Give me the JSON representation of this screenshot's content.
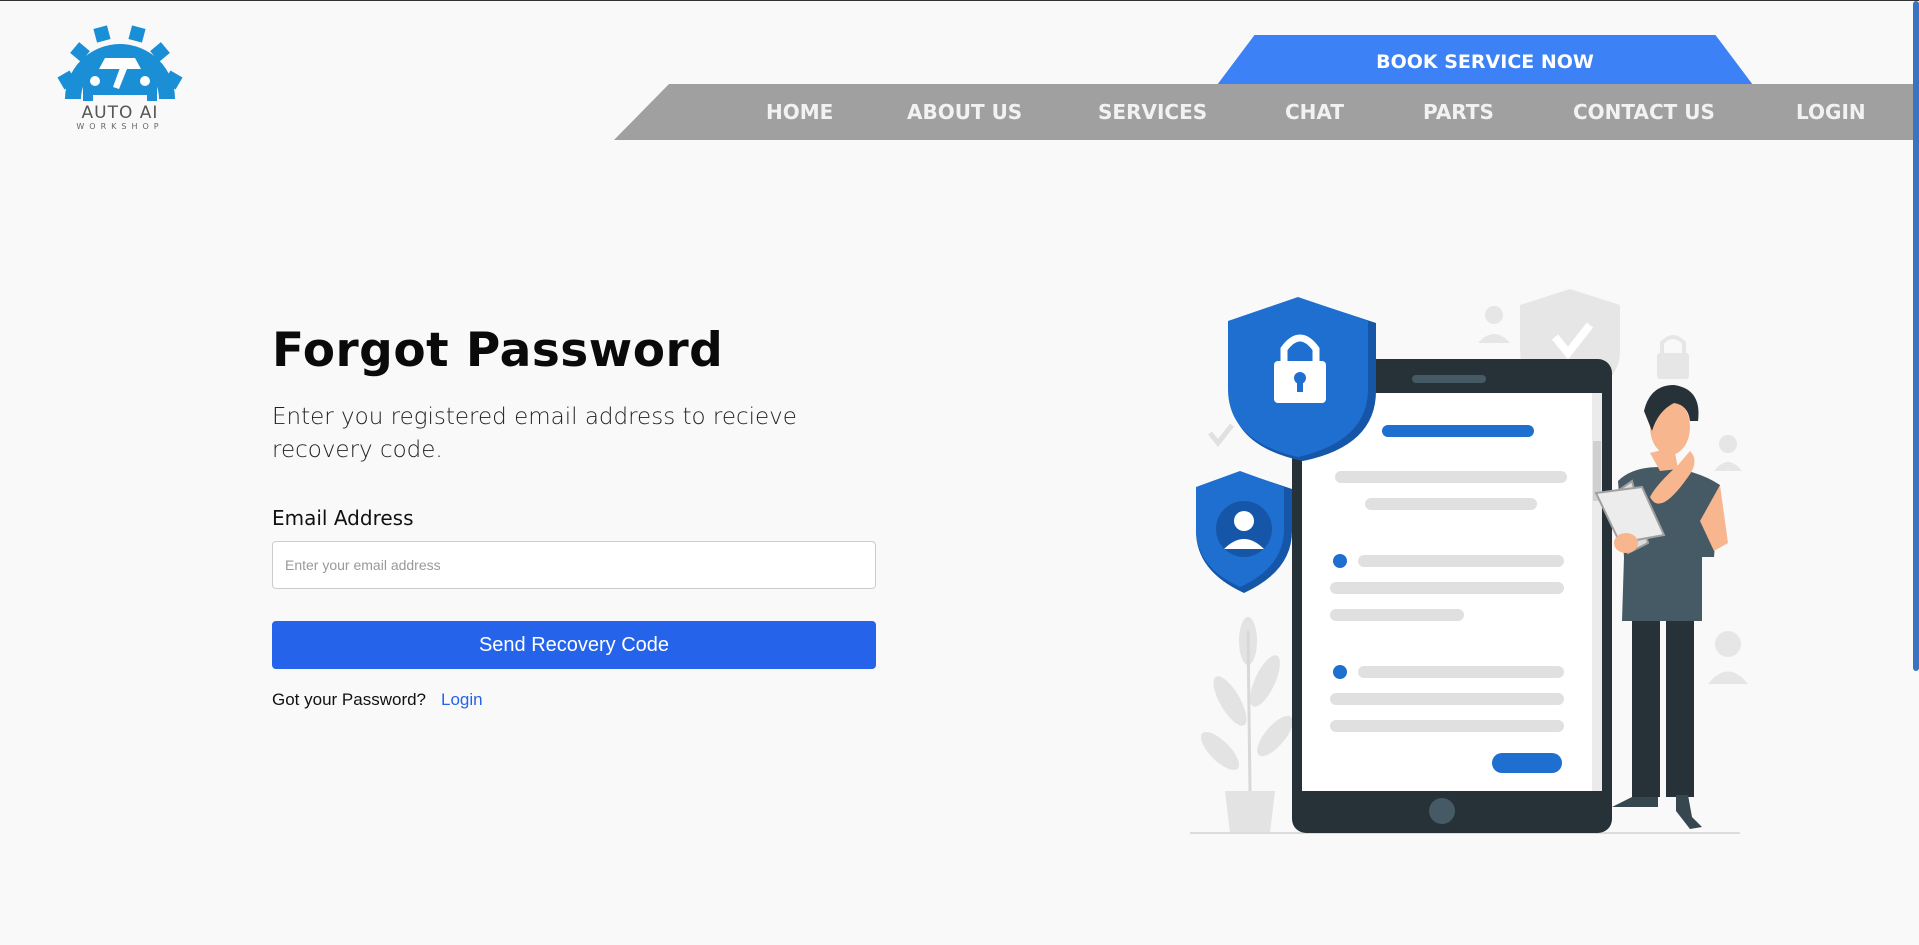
{
  "logo": {
    "title": "AUTO AI",
    "subtitle": "WORKSHOP"
  },
  "header": {
    "book_label": "BOOK SERVICE NOW",
    "nav": [
      {
        "label": "HOME"
      },
      {
        "label": "ABOUT US"
      },
      {
        "label": "SERVICES"
      },
      {
        "label": "CHAT"
      },
      {
        "label": "PARTS"
      },
      {
        "label": "CONTACT US"
      },
      {
        "label": "LOGIN"
      }
    ]
  },
  "form": {
    "title": "Forgot Password",
    "subtitle": "Enter you registered email address to recieve recovery code.",
    "email_label": "Email Address",
    "email_placeholder": "Enter your email address",
    "email_value": "",
    "submit_label": "Send Recovery Code",
    "footer_text": "Got your Password?",
    "footer_link": "Login"
  },
  "colors": {
    "accent": "#2563eb",
    "book_button": "#3c82f6",
    "nav_bg": "#a0a0a0",
    "logo_blue": "#1a8fd6",
    "illustration_blue": "#1e6fd0"
  }
}
